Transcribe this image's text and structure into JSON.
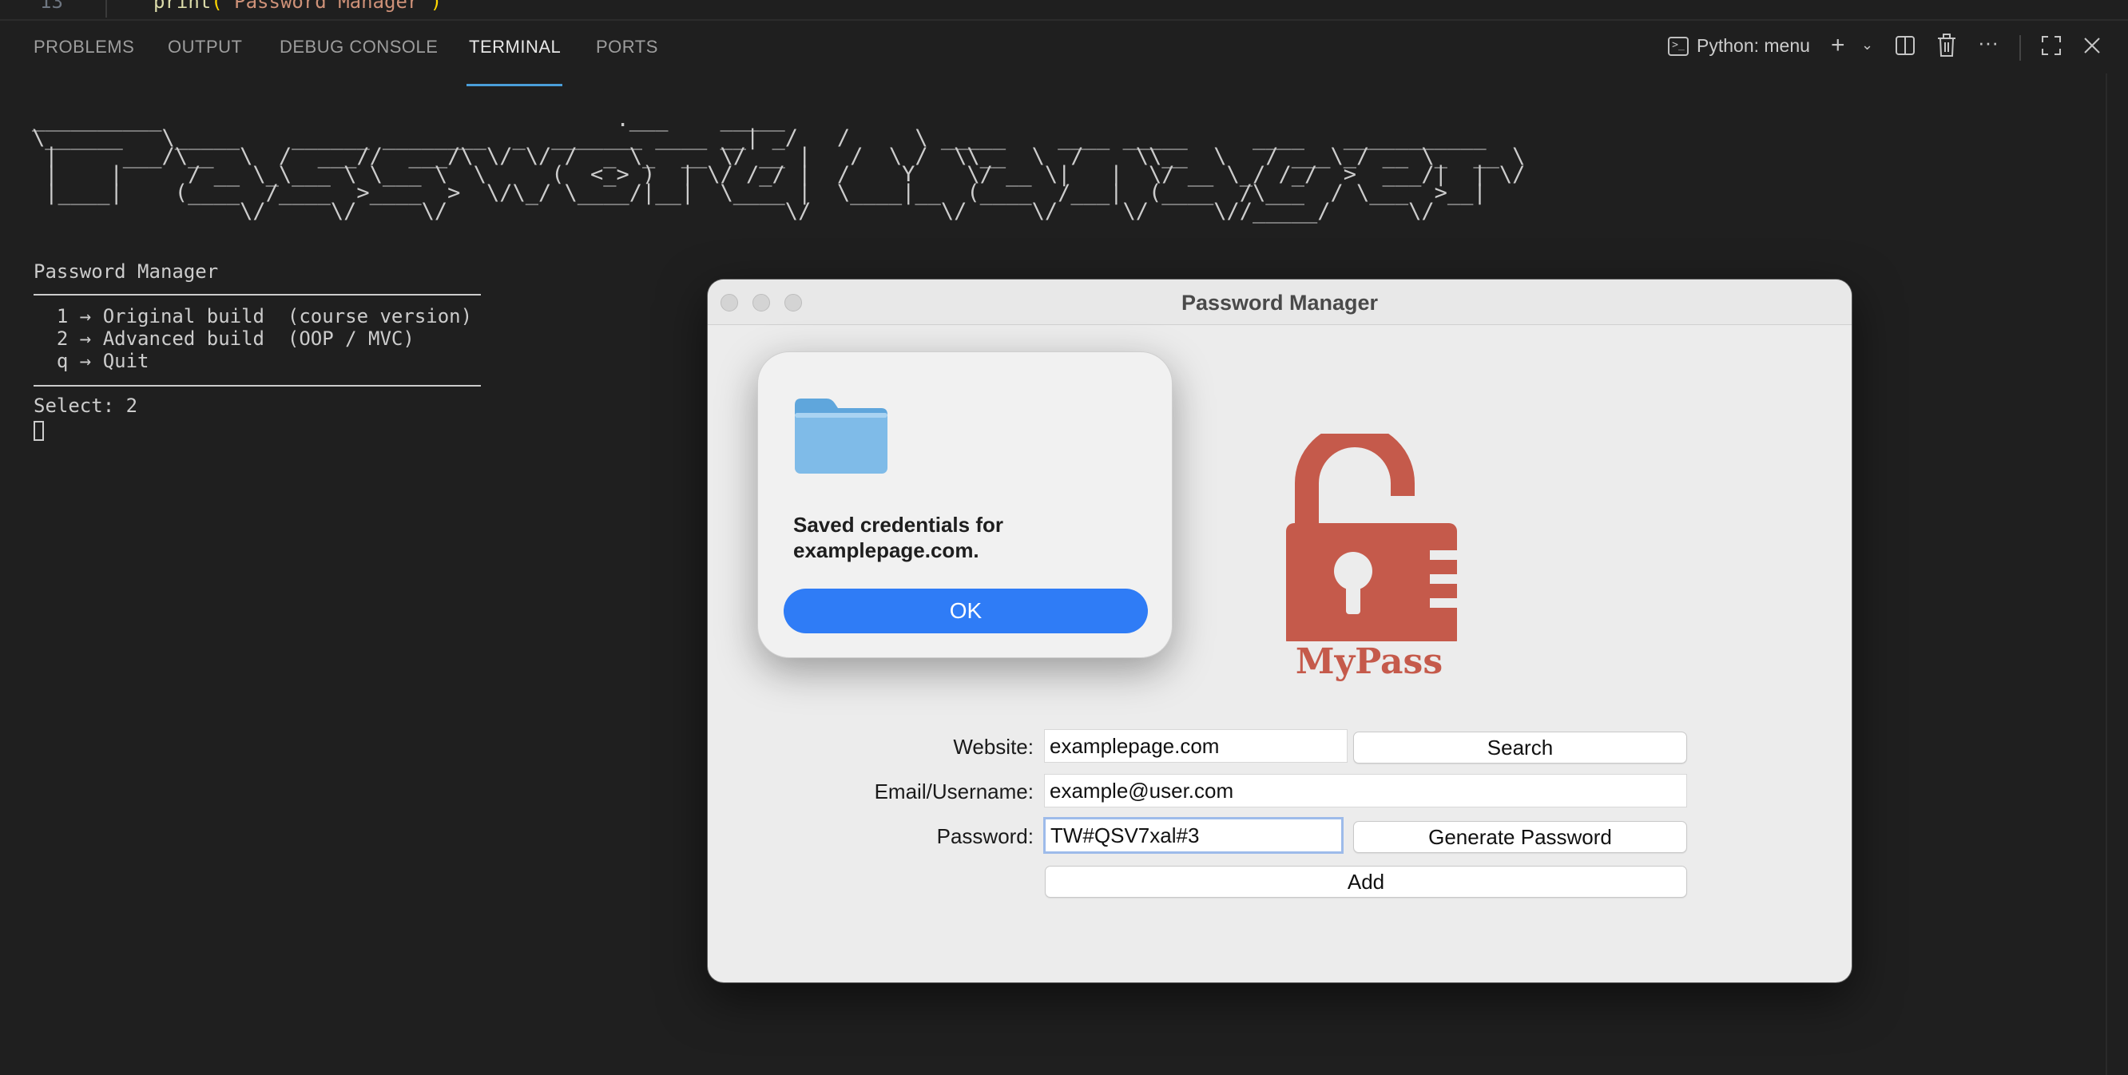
{
  "editor": {
    "line_number": "13",
    "code_func": "print",
    "code_string": "\"Password Manager\""
  },
  "panel": {
    "tabs": [
      {
        "label": "PROBLEMS"
      },
      {
        "label": "OUTPUT"
      },
      {
        "label": "DEBUG CONSOLE"
      },
      {
        "label": "TERMINAL",
        "active": true
      },
      {
        "label": "PORTS"
      }
    ],
    "terminal_name": "Python: menu",
    "icons": [
      "terminal-icon",
      "plus-icon",
      "chevron-down-icon",
      "split-icon",
      "trash-icon",
      "more-icon",
      "maximize-icon",
      "close-icon"
    ],
    "accent_color": "#4a9eda"
  },
  "terminal": {
    "ascii_banner": "__________                                   .___    _____\n\\______   \\_____    ______ ________  _  _______ ____ __| _/   /     \\ _____    ____ _____     ____   ___________\n |     ___/\\__  \\  /  ___//  ___/\\ \\/ \\/ /  _ \\_  __ \\/ __ |   /  \\ /  \\\\__  \\  /    \\\\__  \\   / ___\\_/ __ \\_  __ \\\n |    |     / __ \\_\\___ \\ \\___ \\  \\     (  <_> )  | \\/ /_/ |  /    Y    \\/ __ \\|   |  \\/ __ \\_/ /_/  >  ___/|  | \\/\n |____|    (____  /____  >____  >  \\/\\_/ \\____/|__|  \\____ |  \\____|__  (____  /___|  (____  /\\___  / \\___  >__|\n                \\/     \\/     \\/                          \\/          \\/     \\/     \\/     \\//_____/      \\/",
    "heading": "Password Manager",
    "options": [
      "  1 → Original build  (course version)",
      "  2 → Advanced build  (OOP / MVC)",
      "  q → Quit"
    ],
    "prompt": "Select: 2"
  },
  "window": {
    "title": "Password Manager",
    "logo_text": "MyPass",
    "logo_color": "#c55a4b",
    "website_label": "Website:",
    "website_value": "examplepage.com",
    "search_label": "Search",
    "email_label": "Email/Username:",
    "email_value": "example@user.com",
    "password_label": "Password:",
    "password_value": "TW#QSV7xal#3",
    "generate_label": "Generate Password",
    "add_label": "Add"
  },
  "alert": {
    "message": "Saved credentials for examplepage.com.",
    "ok_label": "OK",
    "ok_color": "#2f7cf6",
    "icon": "folder-icon"
  }
}
